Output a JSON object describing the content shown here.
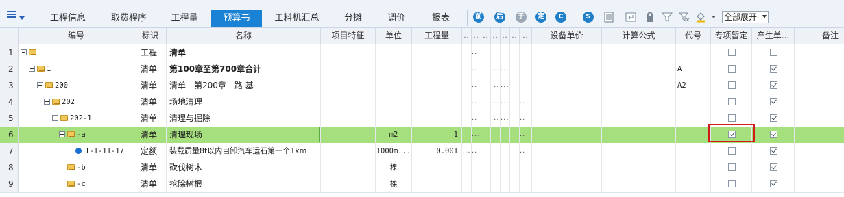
{
  "toolbar": {
    "tabs": [
      "工程信息",
      "取费程序",
      "工程量",
      "预算书",
      "工料机汇总",
      "分摊",
      "调价",
      "报表"
    ],
    "active_tab": "预算书",
    "expand_select": "全部展开",
    "icon_letters": {
      "a": "前",
      "b": "后",
      "c": "子",
      "d": "定",
      "e": "C",
      "f": "S"
    }
  },
  "columns": {
    "code": "编号",
    "mark": "标识",
    "name": "名称",
    "feature": "项目特征",
    "unit": "单位",
    "quantity": "工程量",
    "equip_price": "设备单价",
    "formula": "计算公式",
    "code2": "代号",
    "provisional": "专项暂定",
    "generate": "产生单...",
    "note": "备注"
  },
  "rows": [
    {
      "num": "1",
      "code": "",
      "mark": "工程",
      "name": "清单",
      "unit": "",
      "qty": "",
      "code2": "",
      "prov": false,
      "gen": false,
      "bold": true
    },
    {
      "num": "2",
      "code": "1",
      "mark": "清单",
      "name": "第100章至第700章合计",
      "unit": "",
      "qty": "",
      "code2": "A",
      "prov": false,
      "gen": true,
      "bold": true
    },
    {
      "num": "3",
      "code": "200",
      "mark": "清单",
      "name": "清单　第200章　路 基",
      "unit": "",
      "qty": "",
      "code2": "A2",
      "prov": false,
      "gen": true,
      "bold": false
    },
    {
      "num": "4",
      "code": "202",
      "mark": "清单",
      "name": "场地清理",
      "unit": "",
      "qty": "",
      "code2": "",
      "prov": false,
      "gen": true,
      "bold": false
    },
    {
      "num": "5",
      "code": "202-1",
      "mark": "清单",
      "name": "清理与掘除",
      "unit": "",
      "qty": "",
      "code2": "",
      "prov": false,
      "gen": true,
      "bold": false
    },
    {
      "num": "6",
      "code": "-a",
      "mark": "清单",
      "name": "清理现场",
      "unit": "m2",
      "qty": "1",
      "code2": "",
      "prov": true,
      "gen": true,
      "bold": false
    },
    {
      "num": "7",
      "code": "1-1-11-17",
      "mark": "定额",
      "name": "装载质量8t以内自卸汽车运石第一个1km",
      "unit": "1000m...",
      "qty": "0.001",
      "code2": "",
      "prov": false,
      "gen": true,
      "bold": false
    },
    {
      "num": "8",
      "code": "-b",
      "mark": "清单",
      "name": "砍伐树木",
      "unit": "棵",
      "qty": "",
      "code2": "",
      "prov": false,
      "gen": true,
      "bold": false
    },
    {
      "num": "9",
      "code": "-c",
      "mark": "清单",
      "name": "挖除树根",
      "unit": "棵",
      "qty": "",
      "code2": "",
      "prov": false,
      "gen": true,
      "bold": false
    }
  ],
  "selected_row": 6
}
